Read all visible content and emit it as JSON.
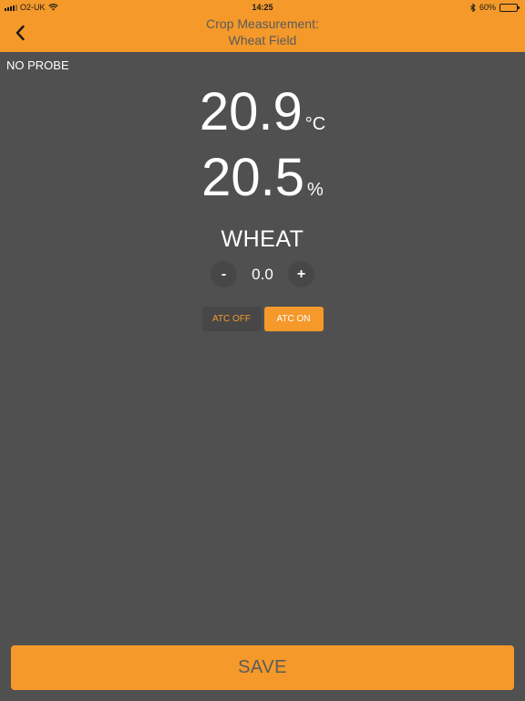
{
  "status_bar": {
    "carrier": "O2-UK",
    "time": "14:25",
    "battery_percent": "60%",
    "battery_level": 0.6,
    "icons": [
      "signal-icon",
      "wifi-icon",
      "bluetooth-icon",
      "battery-icon"
    ]
  },
  "header": {
    "title_line1": "Crop Measurement:",
    "title_line2": "Wheat Field",
    "back_icon": "chevron-left-icon"
  },
  "probe": {
    "status": "NO PROBE"
  },
  "readings": {
    "temperature": {
      "value": "20.9",
      "unit": "°C"
    },
    "moisture": {
      "value": "20.5",
      "unit": "%"
    }
  },
  "crop": {
    "name": "WHEAT",
    "offset_value": "0.0",
    "minus_label": "-",
    "plus_label": "+"
  },
  "atc": {
    "off_label": "ATC OFF",
    "on_label": "ATC ON",
    "selected": "ATC ON"
  },
  "save_label": "SAVE",
  "colors": {
    "accent": "#f4992a",
    "background": "#505050",
    "button_dark": "#474747",
    "header_text": "#5b5b5b"
  }
}
